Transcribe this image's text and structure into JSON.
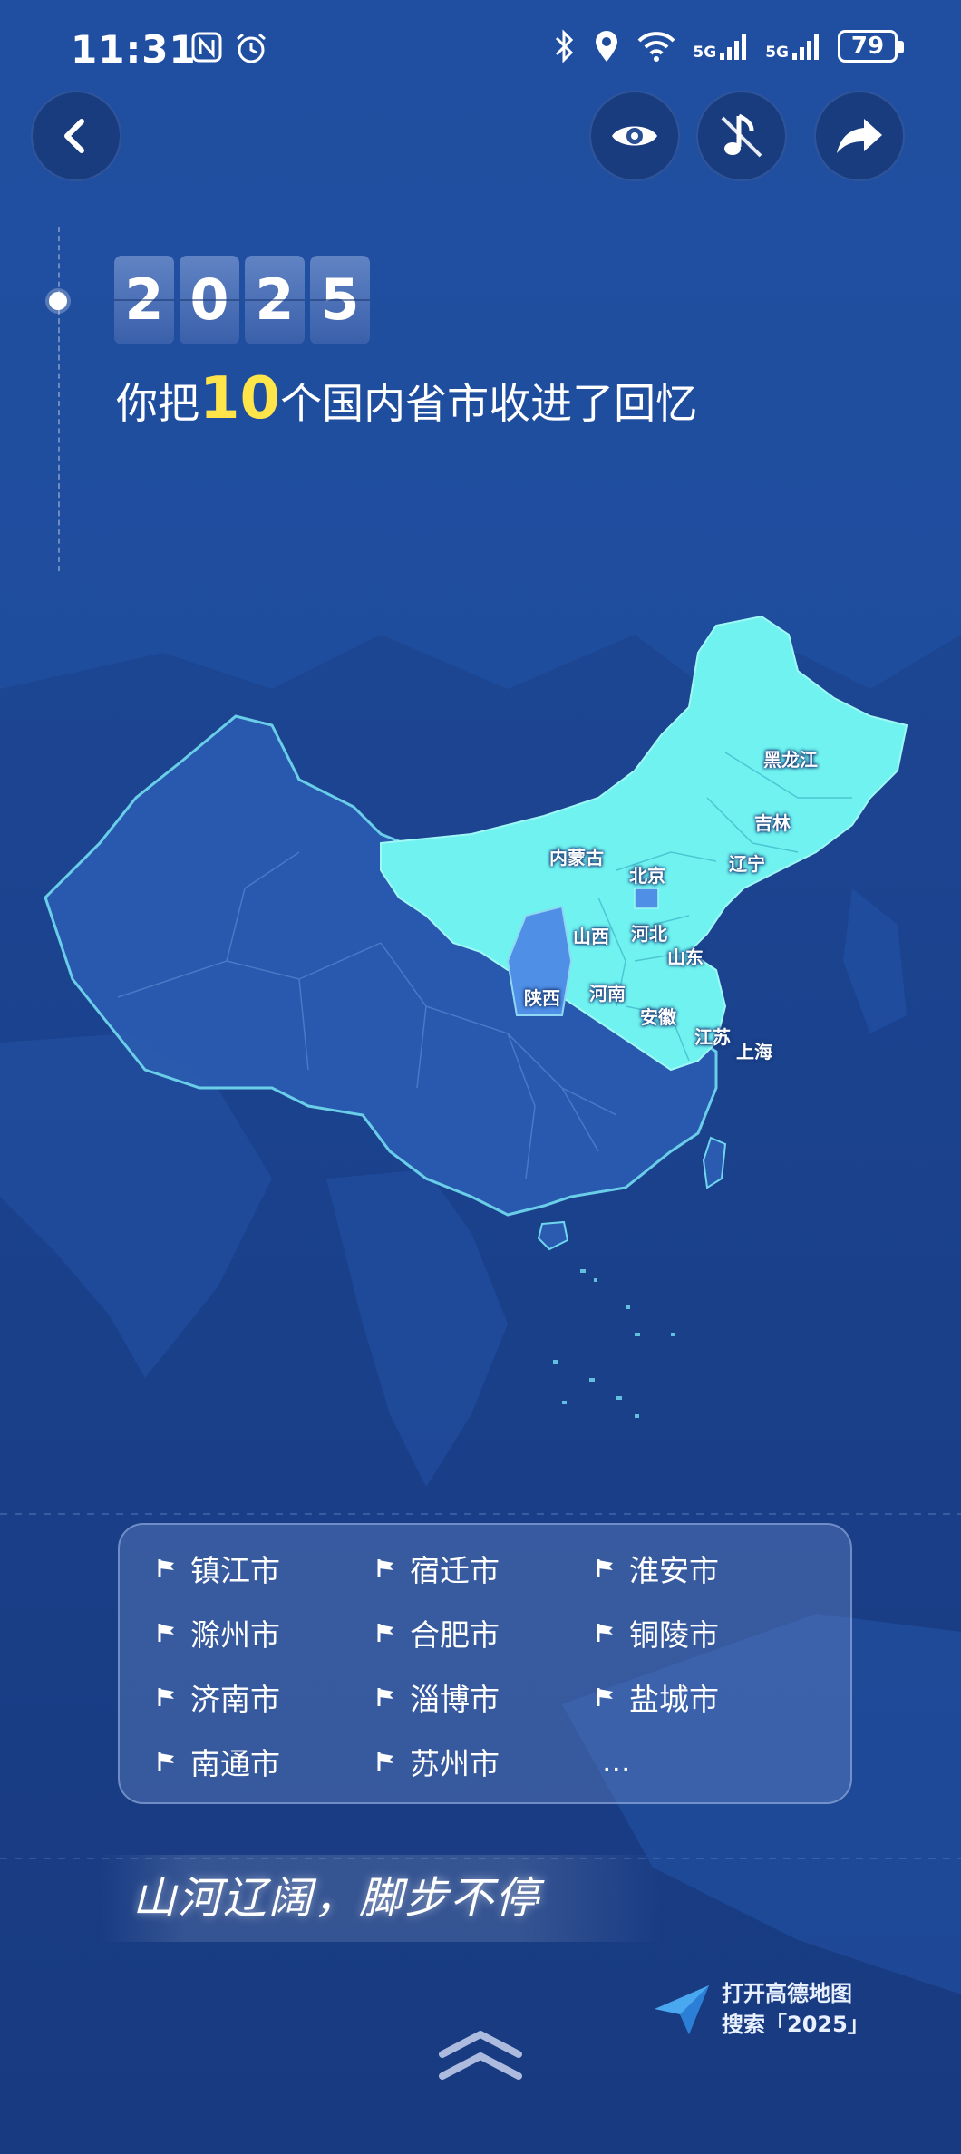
{
  "status_bar": {
    "time": "11:31",
    "network_1": "5G",
    "network_2": "5G",
    "battery": "79"
  },
  "nav": {
    "back_icon": "chevron-left-icon",
    "eye_icon": "eye-icon",
    "music_icon": "music-note-icon",
    "share_icon": "share-arrow-icon"
  },
  "year": {
    "d1": "2",
    "d2": "0",
    "d3": "2",
    "d4": "5"
  },
  "headline": {
    "prefix": "你把",
    "count": "10",
    "suffix": "个国内省市收进了回忆"
  },
  "map": {
    "highlight_color": "#6ff2f0",
    "secondary_color": "#4f8fe6",
    "provinces": [
      "黑龙江",
      "吉林",
      "辽宁",
      "内蒙古",
      "北京",
      "山西",
      "河北",
      "山东",
      "陕西",
      "河南",
      "安徽",
      "江苏",
      "上海"
    ]
  },
  "cities": [
    "镇江市",
    "宿迁市",
    "淮安市",
    "滁州市",
    "合肥市",
    "铜陵市",
    "济南市",
    "淄博市",
    "盐城市",
    "南通市",
    "苏州市",
    "..."
  ],
  "slogan": "山河辽阔，脚步不停",
  "brand": {
    "line1": "打开高德地图",
    "line2": "搜索「2025」"
  }
}
